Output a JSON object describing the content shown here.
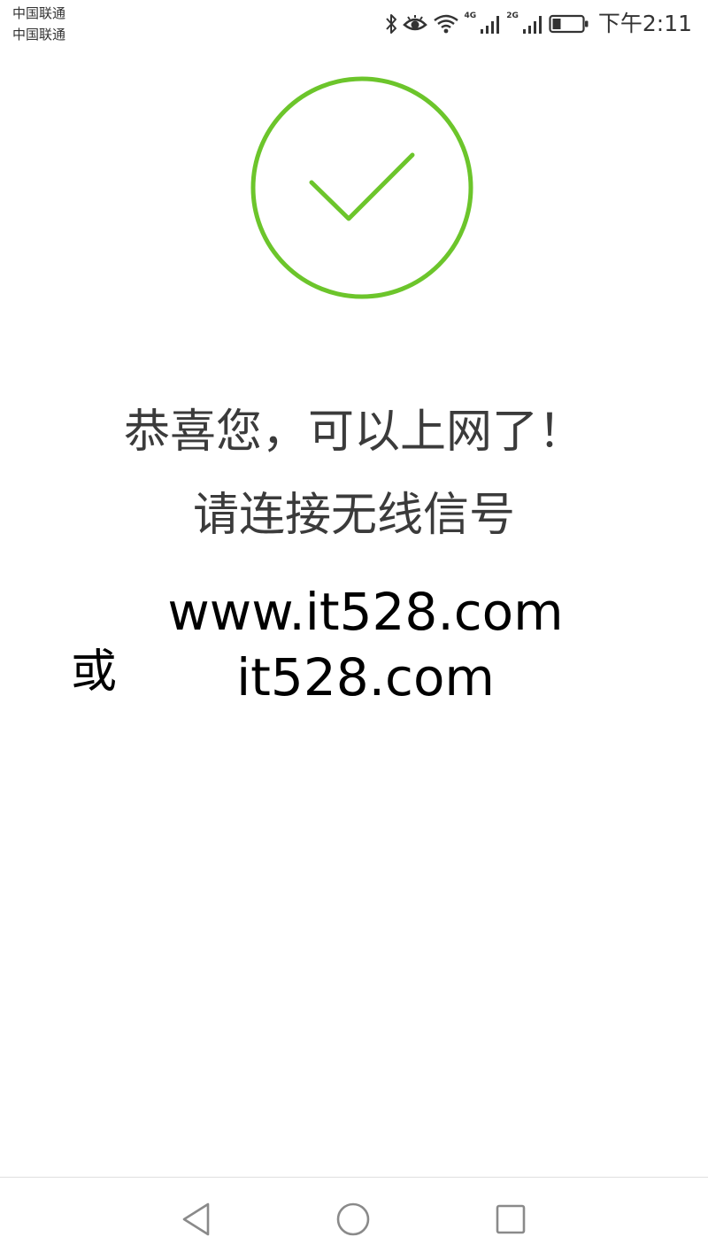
{
  "status_bar": {
    "carrier_1": "中国联通",
    "carrier_2": "中国联通",
    "network_1": "4G",
    "network_2": "2G",
    "time": "下午2:11",
    "icons": [
      "bluetooth-icon",
      "eye-comfort-icon",
      "wifi-icon",
      "signal-icon",
      "signal-icon",
      "battery-icon"
    ]
  },
  "main": {
    "success_icon": "check-circle-icon",
    "accent_color": "#6cc52b",
    "headline_1": "恭喜您，可以上网了！",
    "headline_2": "请连接无线信号",
    "url_1": "www.it528.com",
    "or_label": "或",
    "url_2": "it528.com"
  },
  "nav_bar": {
    "icons": [
      "back-icon",
      "home-icon",
      "recents-icon"
    ]
  }
}
